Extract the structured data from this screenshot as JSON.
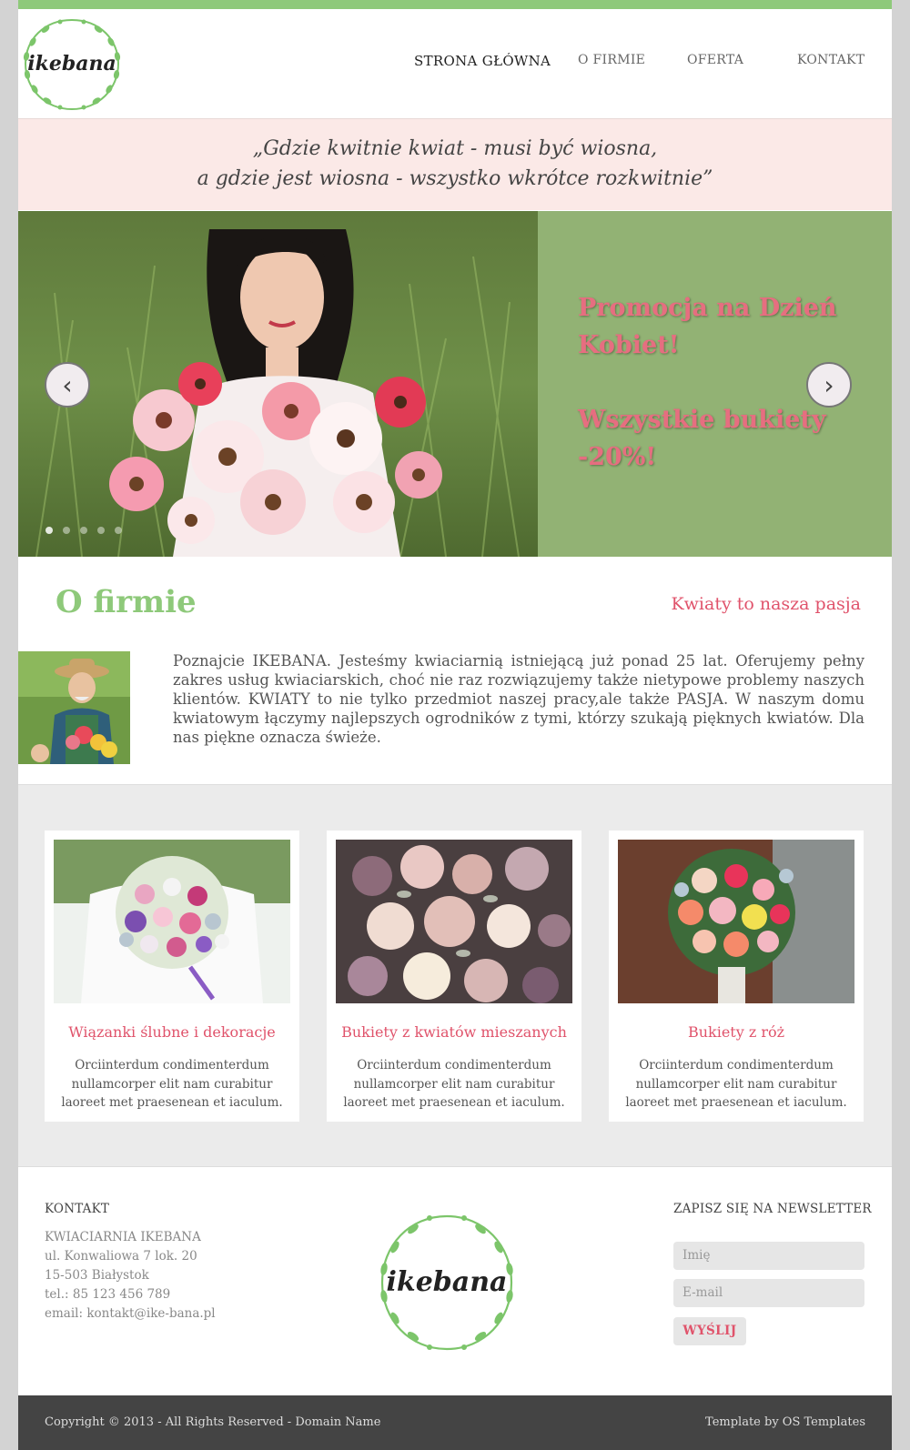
{
  "brand": {
    "name": "ikebana"
  },
  "nav": {
    "items": [
      "STRONA GŁÓWNA",
      "O FIRMIE",
      "OFERTA",
      "KONTAKT"
    ],
    "active": "STRONA GŁÓWNA"
  },
  "quote": {
    "line1": "„Gdzie kwitnie kwiat - musi być wiosna,",
    "line2": "a gdzie jest wiosna - wszystko wkrótce rozkwitnie”"
  },
  "slider": {
    "promo_line1": "Promocja na Dzień Kobiet!",
    "promo_line2": "Wszystkie bukiety -20%!",
    "prev_icon": "‹",
    "next_icon": "›",
    "dots_count": 5,
    "active_dot": 1
  },
  "about": {
    "title": "O firmie",
    "tagline": "Kwiaty to nasza pasja",
    "text": "Poznajcie IKEBANA. Jesteśmy kwiaciarnią istniejącą już ponad 25 lat. Oferujemy pełny zakres usług kwiaciarskich, choć nie raz rozwiązujemy także nietypowe problemy naszych klientów. KWIATY to nie tylko przedmiot naszej pracy,ale także PASJA. W naszym domu kwiatowym łączymy najlepszych ogrodników z tymi, którzy szukają pięknych kwiatów. Dla nas piękne oznacza świeże."
  },
  "features": [
    {
      "title": "Wiązanki ślubne i dekoracje",
      "text": "Orciinterdum condimenterdum nullamcorper elit nam curabitur laoreet met praesenean et iaculum."
    },
    {
      "title": "Bukiety z kwiatów mieszanych",
      "text": "Orciinterdum condimenterdum nullamcorper elit nam curabitur laoreet met praesenean et iaculum."
    },
    {
      "title": "Bukiety z róż",
      "text": "Orciinterdum condimenterdum nullamcorper elit nam curabitur laoreet met praesenean et iaculum."
    }
  ],
  "footer": {
    "contact_heading": "KONTAKT",
    "contact_lines": [
      "KWIACIARNIA IKEBANA",
      "ul. Konwaliowa 7 lok. 20",
      "15-503 Białystok",
      "tel.: 85 123 456 789",
      "email: kontakt@ike-bana.pl"
    ],
    "newsletter_heading": "ZAPISZ SIĘ NA NEWSLETTER",
    "name_placeholder": "Imię",
    "email_placeholder": "E-mail",
    "send_label": "WYŚLIJ",
    "copyright": "Copyright © 2013 - All Rights Reserved - Domain Name",
    "credit": "Template by OS Templates"
  },
  "colors": {
    "accent_green": "#8ec97a",
    "accent_pink": "#e0536b",
    "quote_bg": "#fbe9e7",
    "slider_bg": "#92b274"
  }
}
